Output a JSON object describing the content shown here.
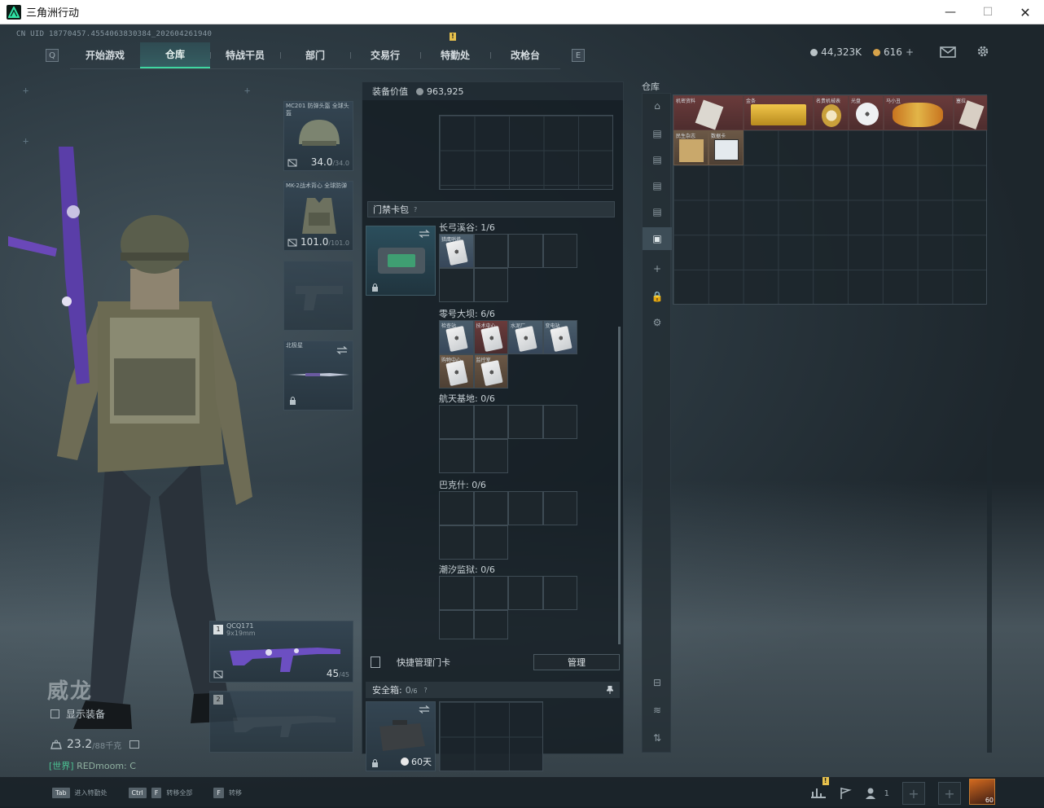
{
  "window": {
    "title": "三角洲行动",
    "minimize": "—",
    "maximize": "☐",
    "close": "✕"
  },
  "uid": "CN UID 18770457.4554063830384_202604261940",
  "nav": {
    "left_key": "Q",
    "right_key": "E",
    "tabs": [
      {
        "label": "开始游戏",
        "active": false
      },
      {
        "label": "仓库",
        "active": true
      },
      {
        "label": "特战干员",
        "active": false
      },
      {
        "label": "部门",
        "active": false
      },
      {
        "label": "交易行",
        "active": false
      },
      {
        "label": "特勤处",
        "active": false,
        "badge": "!"
      },
      {
        "label": "改枪台",
        "active": false
      }
    ]
  },
  "currency": {
    "silver": "44,323K",
    "gold": "616",
    "plus": "+",
    "silver_color": "#b9c2c6",
    "gold_color": "#d6a24a"
  },
  "character": {
    "name": "威龙",
    "show_equipment": "显示装备",
    "weight": "23.2",
    "weight_max": "/88千克",
    "world_tag": "[世界]",
    "world_text": "REDmoom: C"
  },
  "slots": {
    "helmet": {
      "name": "MC201 防弹头盔 全球头盔",
      "durability": "34.0",
      "max": "/34.0"
    },
    "armor": {
      "name": "MK-2战术背心 全球防弹",
      "durability": "101.0",
      "max": "/101.0"
    },
    "melee": {
      "name": "北极星"
    },
    "primary": {
      "index": "1",
      "name": "QCQ171",
      "ammo_type": "9x19mm",
      "ammo": "45",
      "ammo_max": "/45"
    },
    "secondary": {
      "index": "2"
    }
  },
  "center": {
    "equipment_value_label": "装备价值",
    "equipment_value": "963,925",
    "card_bag_title": "门禁卡包",
    "card_bag_q": "?",
    "maps": [
      {
        "label": "长弓溪谷: 1/6",
        "cards": [
          {
            "name": "猎鹰哨塔",
            "color": "blue"
          }
        ]
      },
      {
        "label": "零号大坝: 6/6",
        "cards": [
          {
            "name": "检查站",
            "color": "blue"
          },
          {
            "name": "技术中心",
            "color": "red"
          },
          {
            "name": "水泥厂",
            "color": "blue"
          },
          {
            "name": "变电站",
            "color": "blue"
          },
          {
            "name": "购物中心",
            "color": "brown"
          },
          {
            "name": "监控室",
            "color": "brown"
          }
        ]
      },
      {
        "label": "航天基地: 0/6",
        "cards": []
      },
      {
        "label": "巴克什: 0/6",
        "cards": []
      },
      {
        "label": "潮汐监狱: 0/6",
        "cards": []
      }
    ],
    "quick_manage_label": "快捷管理门卡",
    "manage_button": "管理",
    "safebox_title": "安全箱:",
    "safebox_count": "0",
    "safebox_max": "/6",
    "safebox_q": "?",
    "safebox_days": "60天"
  },
  "warehouse": {
    "title": "仓库",
    "items": [
      {
        "name": "机密资料",
        "color": "red"
      },
      {
        "name": "金条",
        "color": "red"
      },
      {
        "name": "名贵机械表",
        "color": "red"
      },
      {
        "name": "光盘",
        "color": "red"
      },
      {
        "name": "马小丑",
        "color": "red"
      },
      {
        "name": "塞拉",
        "color": "red"
      },
      {
        "name": "民生杂志",
        "color": "brown"
      },
      {
        "name": "数据卡",
        "color": "brown"
      }
    ]
  },
  "bottom": {
    "hints": [
      {
        "key": "Tab",
        "label": "进入特勤处"
      },
      {
        "key": "Ctrl",
        "key2": "F",
        "label": "转移全部"
      },
      {
        "key": "F",
        "label": "转移"
      }
    ],
    "friends": "1",
    "avatar_level": "60",
    "badge": "!"
  }
}
